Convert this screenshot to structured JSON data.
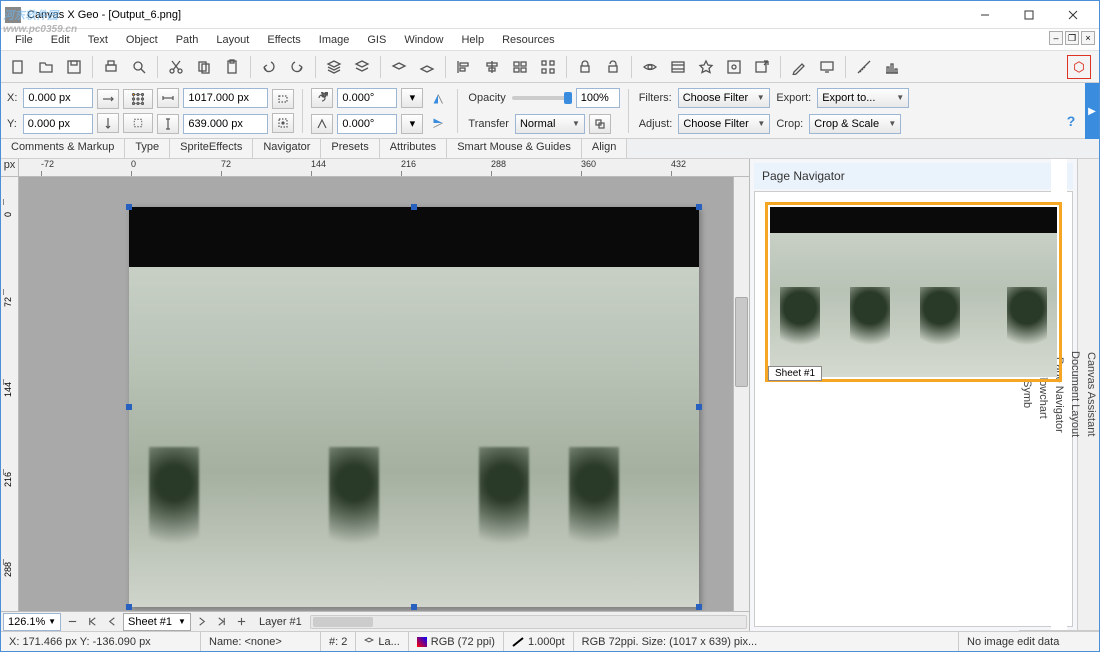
{
  "window": {
    "title": "Canvas X Geo - [Output_6.png]"
  },
  "menu": [
    "File",
    "Edit",
    "Text",
    "Object",
    "Path",
    "Layout",
    "Effects",
    "Image",
    "GIS",
    "Window",
    "Help",
    "Resources"
  ],
  "props": {
    "x_label": "X:",
    "y_label": "Y:",
    "x_value": "0.000 px",
    "y_value": "0.000 px",
    "w_value": "1017.000 px",
    "h_value": "639.000 px",
    "rot1": "0.000°",
    "rot2": "0.000°",
    "opacity_label": "Opacity",
    "opacity_value": "100%",
    "transfer_label": "Transfer",
    "transfer_value": "Normal",
    "filters_label": "Filters:",
    "filters_value": "Choose Filter",
    "adjust_label": "Adjust:",
    "adjust_value": "Choose Filter",
    "export_label": "Export:",
    "export_value": "Export to...",
    "crop_label": "Crop:",
    "crop_value": "Crop & Scale"
  },
  "palette_tabs": [
    "Comments & Markup",
    "Type",
    "SpriteEffects",
    "Navigator",
    "Presets",
    "Attributes",
    "Smart Mouse & Guides",
    "Align"
  ],
  "ruler": {
    "unit": "px",
    "hticks": [
      "-72",
      "0",
      "72",
      "144",
      "216",
      "288",
      "360",
      "432"
    ],
    "vticks": [
      "0",
      "72",
      "144",
      "216",
      "288"
    ]
  },
  "bottom": {
    "zoom": "126.1%",
    "sheet": "Sheet #1",
    "layer": "Layer #1"
  },
  "navigator": {
    "title": "Page Navigator",
    "sheet_label": "Sheet #1"
  },
  "sidetabs": [
    "Canvas Assistant",
    "Document Layout",
    "Page Navigator",
    "Flowchart",
    "Symb"
  ],
  "status": {
    "pos": "X: 171.466 px Y: -136.090 px",
    "name": "Name: <none>",
    "count": "#: 2",
    "layer_short": "La...",
    "color": "RGB (72 ppi)",
    "stroke": "1.000pt",
    "info": "RGB 72ppi. Size: (1017 x 639) pix...",
    "edit": "No image edit data"
  },
  "watermark": {
    "main": "河东软件园",
    "sub": "www.pc0359.cn"
  }
}
